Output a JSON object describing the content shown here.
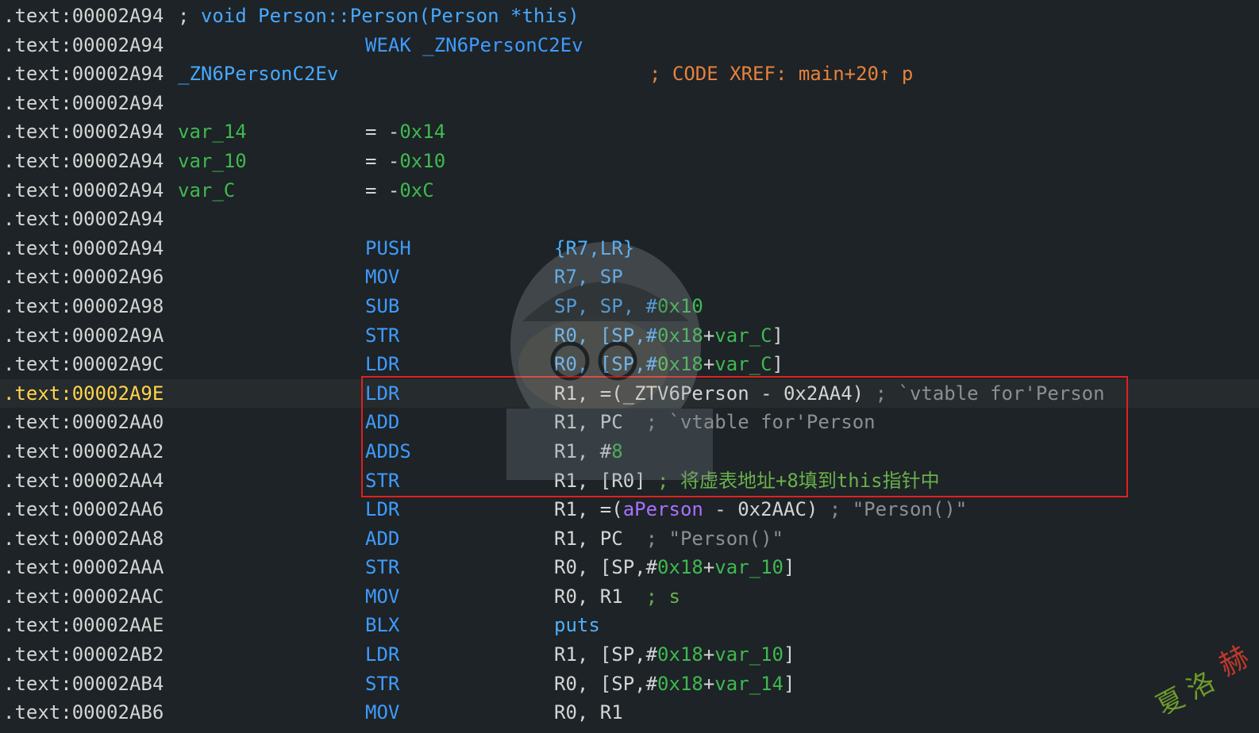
{
  "header": {
    "signature_addr": ".text:00002A94",
    "signature_semi": ";",
    "signature_text": " void Person::Person(Person *this)",
    "weak_addr": ".text:00002A94",
    "weak_text": "WEAK _ZN6PersonC2Ev",
    "func_addr": ".text:00002A94",
    "func_label": "_ZN6PersonC2Ev",
    "xref": "; CODE XREF: main+20↑ p",
    "blank1_addr": ".text:00002A94",
    "vars": [
      {
        "addr": ".text:00002A94",
        "name": "var_14",
        "eq": "= -",
        "value": "0x14"
      },
      {
        "addr": ".text:00002A94",
        "name": "var_10",
        "eq": "= -",
        "value": "0x10"
      },
      {
        "addr": ".text:00002A94",
        "name": "var_C",
        "eq": "= -",
        "value": "0xC"
      }
    ],
    "blank2_addr": ".text:00002A94"
  },
  "instructions": [
    {
      "addr": ".text:00002A94",
      "mnem": "PUSH",
      "ops": [
        {
          "t": "{R7,LR}",
          "c": "reg"
        }
      ]
    },
    {
      "addr": ".text:00002A96",
      "mnem": "MOV",
      "ops": [
        {
          "t": "R7, SP",
          "c": "reg"
        }
      ]
    },
    {
      "addr": ".text:00002A98",
      "mnem": "SUB",
      "ops": [
        {
          "t": "SP, SP, #",
          "c": "reg"
        },
        {
          "t": "0x10",
          "c": "num"
        }
      ]
    },
    {
      "addr": ".text:00002A9A",
      "mnem": "STR",
      "ops": [
        {
          "t": "R0, [SP,#",
          "c": "reg"
        },
        {
          "t": "0x18",
          "c": "num"
        },
        {
          "t": "+",
          "c": "plain"
        },
        {
          "t": "var_C",
          "c": "var"
        },
        {
          "t": "]",
          "c": "plain"
        }
      ]
    },
    {
      "addr": ".text:00002A9C",
      "mnem": "LDR",
      "ops": [
        {
          "t": "R0, [SP,#",
          "c": "reg"
        },
        {
          "t": "0x18",
          "c": "num"
        },
        {
          "t": "+",
          "c": "plain"
        },
        {
          "t": "var_C",
          "c": "var"
        },
        {
          "t": "]",
          "c": "plain"
        }
      ]
    },
    {
      "addr": ".text:00002A9E",
      "mnem": "LDR",
      "current": true,
      "ops": [
        {
          "t": "R1, =(_ZTV6Person - 0x2AA4)",
          "c": "plain"
        },
        {
          "t": " ; `vtable for'Person",
          "c": "cmt"
        }
      ]
    },
    {
      "addr": ".text:00002AA0",
      "mnem": "ADD",
      "ops": [
        {
          "t": "R1, PC",
          "c": "plain"
        },
        {
          "t": "  ; `vtable for'Person",
          "c": "cmt"
        }
      ]
    },
    {
      "addr": ".text:00002AA2",
      "mnem": "ADDS",
      "ops": [
        {
          "t": "R1, #",
          "c": "plain"
        },
        {
          "t": "8",
          "c": "num"
        }
      ]
    },
    {
      "addr": ".text:00002AA4",
      "mnem": "STR",
      "ops": [
        {
          "t": "R1, [R0]",
          "c": "plain"
        },
        {
          "t": " ; 将虚表地址+8填到this指针中",
          "c": "cmt-cn"
        }
      ]
    },
    {
      "addr": ".text:00002AA6",
      "mnem": "LDR",
      "ops": [
        {
          "t": "R1, =(",
          "c": "plain"
        },
        {
          "t": "aPerson",
          "c": "sym"
        },
        {
          "t": " - 0x2AAC)",
          "c": "plain"
        },
        {
          "t": " ; \"Person()\"",
          "c": "cmt"
        }
      ]
    },
    {
      "addr": ".text:00002AA8",
      "mnem": "ADD",
      "ops": [
        {
          "t": "R1, PC",
          "c": "plain"
        },
        {
          "t": "  ; \"Person()\"",
          "c": "cmt"
        }
      ]
    },
    {
      "addr": ".text:00002AAA",
      "mnem": "STR",
      "ops": [
        {
          "t": "R0, [SP,#",
          "c": "plain"
        },
        {
          "t": "0x18",
          "c": "num"
        },
        {
          "t": "+",
          "c": "plain"
        },
        {
          "t": "var_10",
          "c": "var"
        },
        {
          "t": "]",
          "c": "plain"
        }
      ]
    },
    {
      "addr": ".text:00002AAC",
      "mnem": "MOV",
      "ops": [
        {
          "t": "R0, R1",
          "c": "plain"
        },
        {
          "t": "  ; s",
          "c": "cmt-cn"
        }
      ]
    },
    {
      "addr": ".text:00002AAE",
      "mnem": "BLX",
      "ops": [
        {
          "t": "puts",
          "c": "reg"
        }
      ]
    },
    {
      "addr": ".text:00002AB2",
      "mnem": "LDR",
      "ops": [
        {
          "t": "R1, [SP,#",
          "c": "plain"
        },
        {
          "t": "0x18",
          "c": "num"
        },
        {
          "t": "+",
          "c": "plain"
        },
        {
          "t": "var_10",
          "c": "var"
        },
        {
          "t": "]",
          "c": "plain"
        }
      ]
    },
    {
      "addr": ".text:00002AB4",
      "mnem": "STR",
      "ops": [
        {
          "t": "R0, [SP,#",
          "c": "plain"
        },
        {
          "t": "0x18",
          "c": "num"
        },
        {
          "t": "+",
          "c": "plain"
        },
        {
          "t": "var_14",
          "c": "var"
        },
        {
          "t": "]",
          "c": "plain"
        }
      ]
    },
    {
      "addr": ".text:00002AB6",
      "mnem": "MOV",
      "ops": [
        {
          "t": "R0, R1",
          "c": "plain"
        }
      ]
    }
  ],
  "stamp_text": "夏洛赫",
  "colors": {
    "highlight_box": "#e02020",
    "current_addr": "#ffd54a",
    "mnemonic": "#3f9bff",
    "number": "#3fb950"
  }
}
